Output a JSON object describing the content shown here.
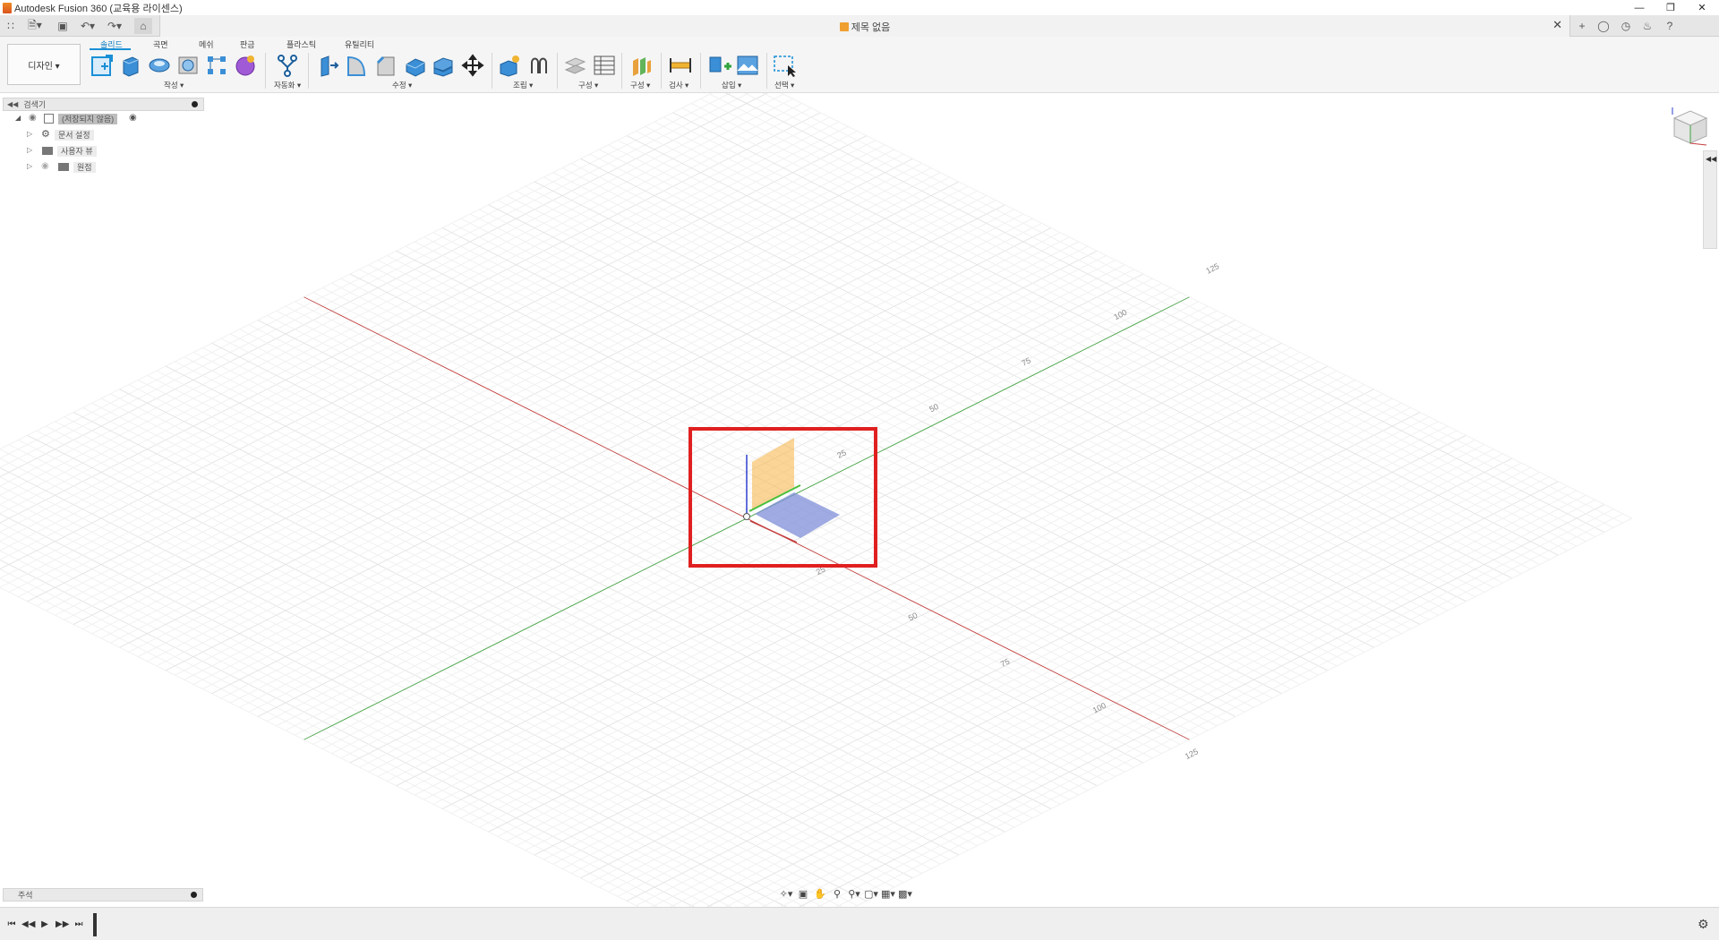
{
  "window": {
    "title": "Autodesk Fusion 360 (교육용 라이센스)",
    "controls": [
      "minimize",
      "restore",
      "close"
    ]
  },
  "document": {
    "tab_title": "제목 없음",
    "icons": [
      "grid-icon",
      "file-icon",
      "save-icon",
      "undo-icon",
      "redo-icon",
      "home-icon"
    ]
  },
  "header_right_icons": [
    "new-tab-icon",
    "extension-icon",
    "history-icon",
    "bell-icon",
    "help-icon"
  ],
  "toolbar": {
    "workspace": "디자인 ▾",
    "tabs": [
      "솔리드",
      "곡면",
      "메쉬",
      "판금",
      "플라스틱",
      "유틸리티"
    ],
    "active_tab": "솔리드",
    "groups": [
      {
        "label": "작성 ▾"
      },
      {
        "label": "자동화 ▾"
      },
      {
        "label": "수정 ▾"
      },
      {
        "label": "조립 ▾"
      },
      {
        "label": "구성 ▾"
      },
      {
        "label": "구성 ▾"
      },
      {
        "label": "검사 ▾"
      },
      {
        "label": "삽입 ▾"
      },
      {
        "label": "선택 ▾"
      }
    ]
  },
  "browser": {
    "header": "검색기",
    "root": "(저장되지 않음)",
    "items": [
      {
        "label": "문서 설정",
        "icon": "gear-icon"
      },
      {
        "label": "사용자 뷰",
        "icon": "folder-icon"
      },
      {
        "label": "원점",
        "icon": "folder-icon"
      }
    ]
  },
  "viewport": {
    "grid_labels_green": [
      "25",
      "50",
      "75",
      "100",
      "125"
    ],
    "grid_labels_red": [
      "25",
      "50",
      "75",
      "100",
      "125"
    ],
    "axis_colors": {
      "x": "#c43c3c",
      "y": "#3ea23e",
      "z": "#2e3fd0"
    },
    "plane_colors": {
      "xz": "#f5b342",
      "xy": "#7f8fd8"
    },
    "highlight_color": "#e02020"
  },
  "annotation_panel": {
    "label": "주석"
  },
  "navbar_icons": [
    "orbit-icon",
    "look-at-icon",
    "pan-icon",
    "zoom-icon",
    "fit-icon",
    "display-icon",
    "grid-icon",
    "viewport-icon"
  ],
  "timeline": {
    "buttons": [
      "first",
      "prev",
      "play",
      "next",
      "last"
    ]
  },
  "colors": {
    "accent": "#1a8fd6"
  }
}
